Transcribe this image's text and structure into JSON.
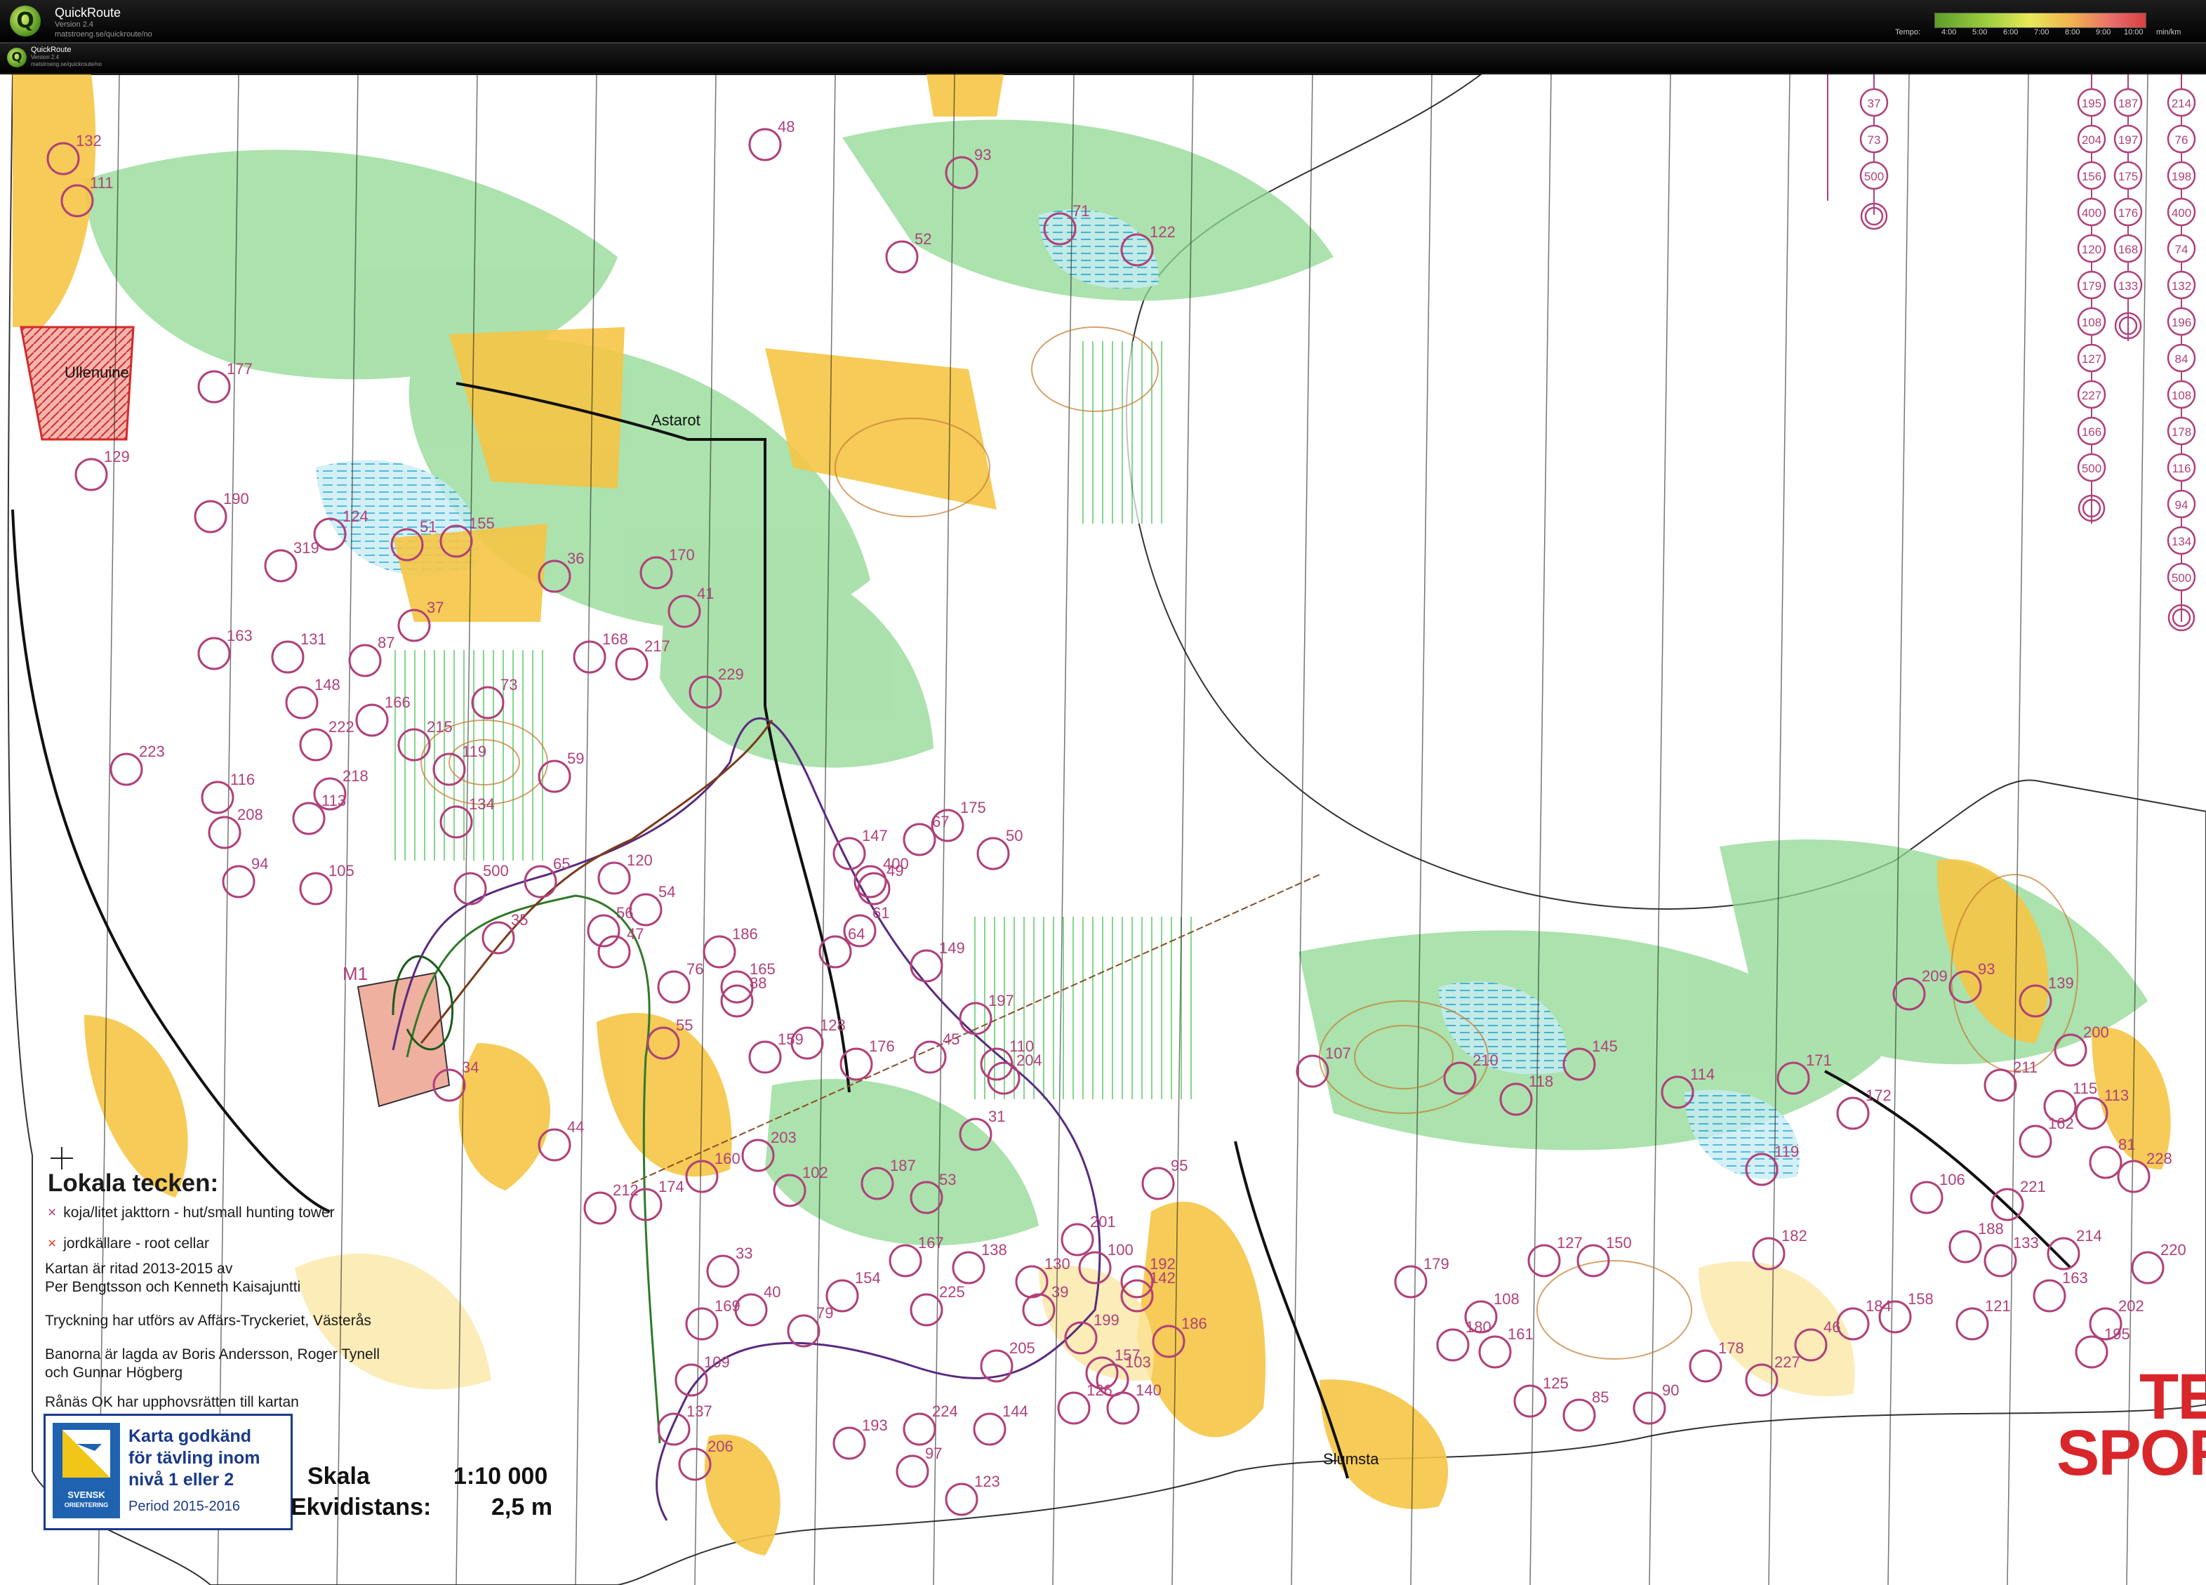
{
  "app": {
    "title": "QuickRoute",
    "version": "Version 2.4",
    "url": "matstroeng.se/quickroute/no",
    "logo_letter": "Q"
  },
  "tempo": {
    "label": "Tempo:",
    "ticks": [
      "4:00",
      "5:00",
      "6:00",
      "7:00",
      "8:00",
      "9:00",
      "10:00",
      "min/km"
    ]
  },
  "map": {
    "place_names": [
      "Astarot",
      "Slumsta",
      "Ullenuine"
    ],
    "features": [
      "M1"
    ],
    "legend": {
      "title": "Lokala tecken:",
      "symbols": [
        {
          "marker": "×",
          "text": "koja/litet jakttorn - hut/small hunting tower"
        },
        {
          "marker": "×",
          "text": "jordkällare   -   root cellar"
        }
      ],
      "credits": [
        "Kartan är ritad 2013-2015 av",
        "Per Bengtsson och Kenneth Kaisajuntti",
        "Tryckning har utförs av Affärs-Tryckeriet, Västerås",
        "Banorna är lagda av Boris Andersson, Roger Tynell",
        "och Gunnar Högberg",
        "Rånäs OK har upphovsrätten till kartan"
      ]
    },
    "approval_badge": {
      "org_line1": "SVENSK",
      "org_line2": "ORIENTERING",
      "line1": "Karta godkänd",
      "line2": "för tävling inom",
      "line3": "nivå 1 eller 2",
      "period": "Period 2015-2016"
    },
    "scale": {
      "label": "Skala",
      "value": "1:10 000",
      "contour_label": "Ekvidistans:",
      "contour_value": "2,5 m"
    },
    "sponsor_text": [
      "TE",
      "SPORT"
    ],
    "course_columns": [
      [
        "37",
        "73",
        "500"
      ],
      [
        "195",
        "204",
        "156",
        "400",
        "120",
        "179",
        "108",
        "127",
        "227",
        "166",
        "500"
      ],
      [
        "187",
        "197",
        "175",
        "176",
        "168",
        "133"
      ],
      [
        "214",
        "76",
        "198",
        "400",
        "74",
        "132",
        "196",
        "84",
        "108",
        "178",
        "116",
        "94",
        "134",
        "500"
      ]
    ],
    "control_codes": [
      "132",
      "111",
      "177",
      "129",
      "190",
      "124",
      "51",
      "155",
      "319",
      "36",
      "170",
      "41",
      "163",
      "131",
      "37",
      "87",
      "168",
      "217",
      "229",
      "148",
      "166",
      "215",
      "222",
      "119",
      "59",
      "218",
      "134",
      "116",
      "113",
      "73",
      "208",
      "94",
      "105",
      "500",
      "65",
      "120",
      "54",
      "223",
      "56",
      "47",
      "55",
      "76",
      "165",
      "35",
      "64",
      "88",
      "61",
      "149",
      "45",
      "110",
      "176",
      "34",
      "44",
      "212",
      "102",
      "186",
      "147",
      "400",
      "175",
      "67",
      "49",
      "50",
      "197",
      "204",
      "31",
      "159",
      "128",
      "203",
      "160",
      "187",
      "53",
      "174",
      "154",
      "167",
      "138",
      "130",
      "39",
      "201",
      "100",
      "192",
      "199",
      "186",
      "157",
      "205",
      "225",
      "79",
      "40",
      "33",
      "169",
      "109",
      "137",
      "206",
      "193",
      "224",
      "144",
      "97",
      "123",
      "126",
      "103",
      "142",
      "140",
      "95",
      "107",
      "210",
      "118",
      "145",
      "114",
      "171",
      "209",
      "93",
      "139",
      "200",
      "211",
      "115",
      "113",
      "162",
      "81",
      "221",
      "228",
      "220",
      "214",
      "188",
      "106",
      "172",
      "119",
      "182",
      "150",
      "127",
      "108",
      "180",
      "179",
      "161",
      "125",
      "85",
      "90",
      "178",
      "227",
      "46",
      "184",
      "158",
      "121",
      "133",
      "163",
      "195",
      "202",
      "48",
      "93",
      "71",
      "52",
      "122"
    ]
  }
}
